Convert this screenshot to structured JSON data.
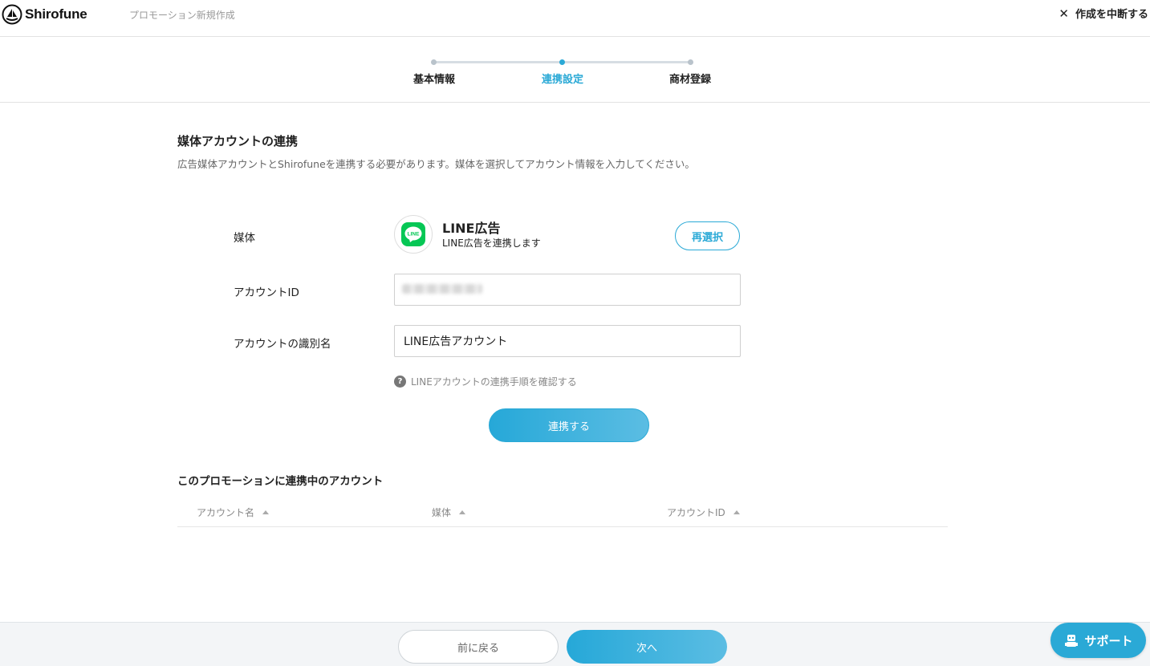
{
  "header": {
    "logo_text": "Shirofune",
    "page_title": "プロモーション新規作成",
    "abort_label": "作成を中断する"
  },
  "stepper": {
    "steps": [
      {
        "label": "基本情報",
        "active": false
      },
      {
        "label": "連携設定",
        "active": true
      },
      {
        "label": "商材登録",
        "active": false
      }
    ]
  },
  "section": {
    "title": "媒体アカウントの連携",
    "description": "広告媒体アカウントとShirofuneを連携する必要があります。媒体を選択してアカウント情報を入力してください。"
  },
  "form": {
    "media_label": "媒体",
    "media_name": "LINE広告",
    "media_sub": "LINE広告を連携します",
    "media_icon_text": "LINE",
    "reselect_label": "再選択",
    "account_id_label": "アカウントID",
    "account_id_value": "",
    "account_name_label": "アカウントの識別名",
    "account_name_value": "LINE広告アカウント",
    "help_text": "LINEアカウントの連携手順を確認する",
    "connect_label": "連携する"
  },
  "linked_accounts": {
    "title": "このプロモーションに連携中のアカウント",
    "columns": [
      "アカウント名",
      "媒体",
      "アカウントID"
    ]
  },
  "footer": {
    "back_label": "前に戻る",
    "next_label": "次へ",
    "support_label": "サポート"
  },
  "colors": {
    "accent": "#2aa9d6",
    "line_green": "#06c755"
  }
}
